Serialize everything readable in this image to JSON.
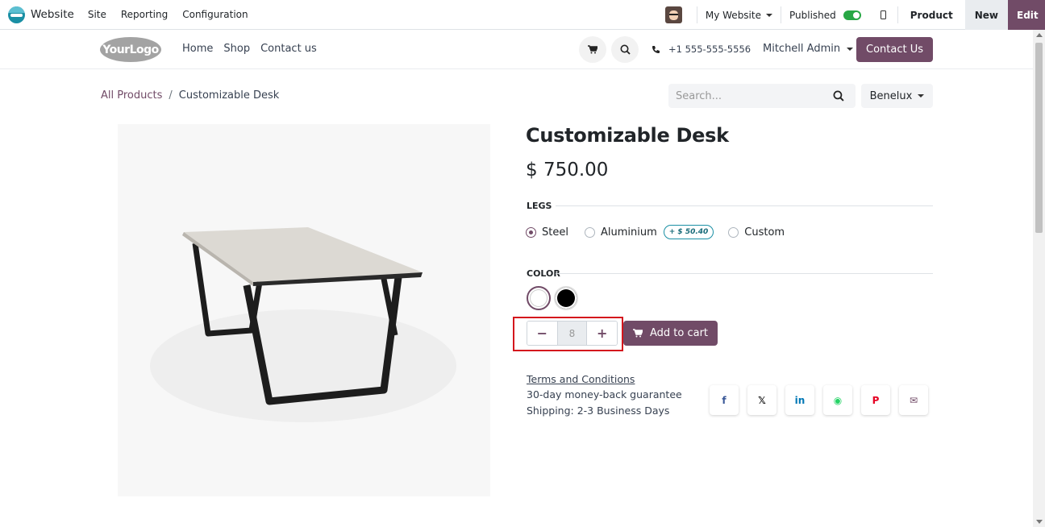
{
  "adminbar": {
    "app_name": "Website",
    "menu": [
      "Site",
      "Reporting",
      "Configuration"
    ],
    "website_selector": "My Website",
    "published_label": "Published",
    "published": true,
    "product_label": "Product",
    "new_label": "New",
    "edit_label": "Edit"
  },
  "header": {
    "logo_text": "YourLogo",
    "nav": [
      "Home",
      "Shop",
      "Contact us"
    ],
    "phone": "+1 555-555-5556",
    "user": "Mitchell Admin",
    "contact_button": "Contact Us"
  },
  "breadcrumb": {
    "parent": "All Products",
    "separator": "/",
    "current": "Customizable Desk"
  },
  "search": {
    "placeholder": "Search..."
  },
  "pricelist": "Benelux",
  "product": {
    "title": "Customizable Desk",
    "price": "$ 750.00",
    "legs_label": "LEGS",
    "legs_options": [
      {
        "label": "Steel",
        "checked": true
      },
      {
        "label": "Aluminium",
        "checked": false,
        "extra": "+ $ 50.40"
      },
      {
        "label": "Custom",
        "checked": false
      }
    ],
    "color_label": "COLOR",
    "colors": [
      {
        "name": "White",
        "hex": "#ffffff",
        "selected": true
      },
      {
        "name": "Black",
        "hex": "#000000",
        "selected": false
      }
    ],
    "quantity": "8",
    "add_to_cart": "Add to cart",
    "terms": "Terms and Conditions",
    "guarantee": "30-day money-back guarantee",
    "shipping": "Shipping: 2-3 Business Days"
  },
  "share": [
    {
      "icon": "facebook-icon",
      "glyph": "f",
      "color": "#3b5998"
    },
    {
      "icon": "x-icon",
      "glyph": "𝕏",
      "color": "#000000"
    },
    {
      "icon": "linkedin-icon",
      "glyph": "in",
      "color": "#0077b5"
    },
    {
      "icon": "whatsapp-icon",
      "glyph": "◉",
      "color": "#25d366"
    },
    {
      "icon": "pinterest-icon",
      "glyph": "P",
      "color": "#e60023"
    },
    {
      "icon": "email-icon",
      "glyph": "✉",
      "color": "#714b67"
    }
  ],
  "colors": {
    "accent": "#714b67",
    "highlight": "#d4161d"
  }
}
